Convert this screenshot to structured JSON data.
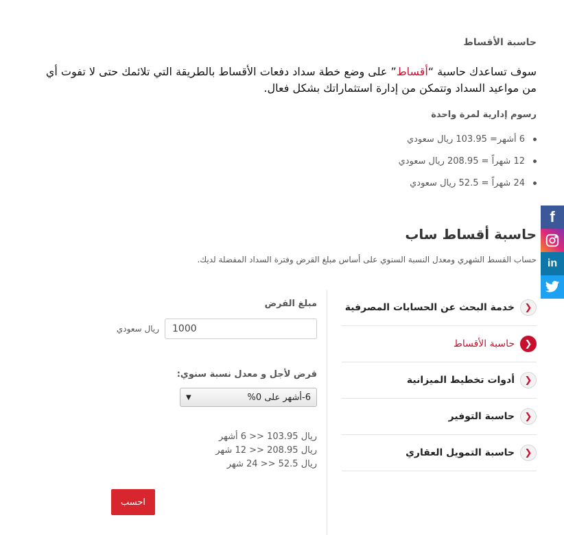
{
  "intro": {
    "title": "حاسبة الأقساط",
    "text_before": "سوف تساعدك حاسبة “",
    "text_highlight": "أقساط",
    "text_after": "” على وضع خطة سداد دفعات الأقساط بالطريقة التي تلائمك حتى لا تفوت أي من مواعيد السداد وتتمكن من إدارة استثماراتك بشكل فعال."
  },
  "fees": {
    "title": "رسوم إدارية لمرة واحدة",
    "items": [
      "6 أشهر=  103.95 ريال سعودي",
      "12 شهراً = 208.95 ريال سعودي",
      "24 شهراً = 52.5 ريال سعودي"
    ]
  },
  "calculator": {
    "title": "حاسبة أقساط ساب",
    "subtitle": "حساب القسط الشهري ومعدل النسبة السنوي على أساس مبلغ القرض وفترة السداد المفضلة لديك."
  },
  "side_menu": {
    "items": [
      {
        "label": "خدمة البحث عن الحسابات المصرفية",
        "active": false
      },
      {
        "label": "حاسبة الأقساط",
        "active": true
      },
      {
        "label": "أدوات تخطيط الميزانية",
        "active": false
      },
      {
        "label": "حاسبة التوفير",
        "active": false
      },
      {
        "label": "حاسبة التمويل العقاري",
        "active": false
      }
    ]
  },
  "form": {
    "amount_label": "مبلغ القرض",
    "amount_value": "1000",
    "currency": "ريال سعودي",
    "term_label": "قرض لأجل و معدل نسبة سنوي:",
    "term_selected": "6-أشهر على 0%",
    "results": [
      "ريال 103.95 << 6 أشهر",
      "ريال 208.95 << 12 شهر",
      "ريال 52.5 << 24 شهر"
    ],
    "submit_label": "احسب"
  },
  "social": {
    "icons": [
      "facebook-icon",
      "instagram-icon",
      "linkedin-icon",
      "twitter-icon"
    ],
    "colors": {
      "facebook": "#3b5998",
      "instagram": "#dd2a7b",
      "linkedin": "#0e76a8",
      "twitter": "#1da1f2"
    }
  },
  "colors": {
    "accent": "#c8102e",
    "button": "#d7262d"
  }
}
